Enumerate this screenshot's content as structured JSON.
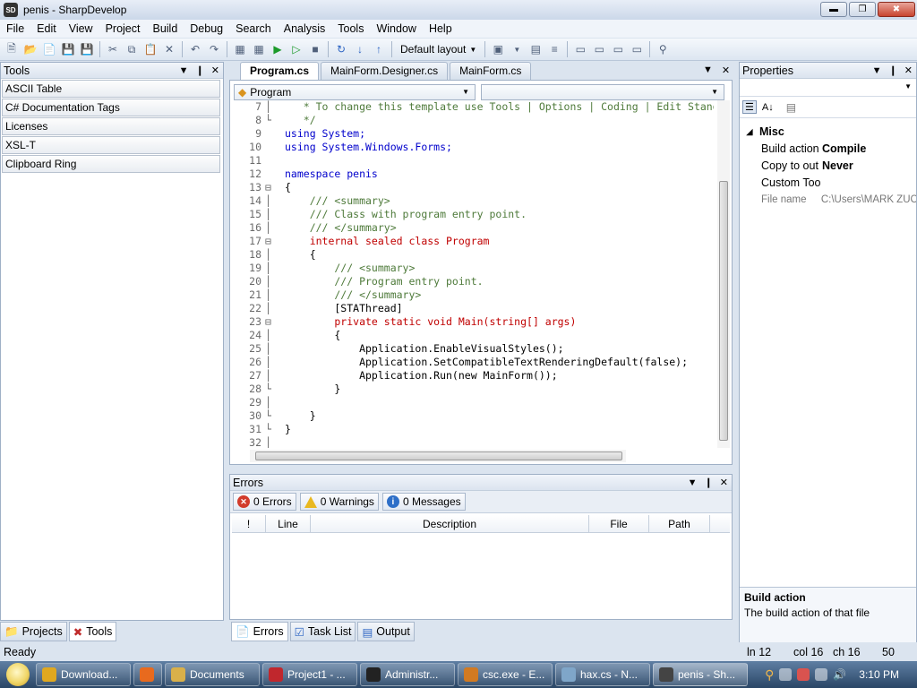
{
  "window": {
    "title": "penis - SharpDevelop"
  },
  "menu": [
    "File",
    "Edit",
    "View",
    "Project",
    "Build",
    "Debug",
    "Search",
    "Analysis",
    "Tools",
    "Window",
    "Help"
  ],
  "toolbar": {
    "layout": "Default layout"
  },
  "tools_panel": {
    "title": "Tools",
    "items": [
      "ASCII Table",
      "C# Documentation Tags",
      "Licenses",
      "XSL-T",
      "Clipboard Ring"
    ],
    "tabs": [
      "Projects",
      "Tools"
    ]
  },
  "editor": {
    "tabs": [
      "Program.cs",
      "MainForm.Designer.cs",
      "MainForm.cs"
    ],
    "class_combo": "Program",
    "member_combo": "",
    "lines": [
      {
        "n": "7",
        "t": "   * To change this template use Tools | Options | Coding | Edit Standard"
      },
      {
        "n": "8",
        "t": "   */"
      },
      {
        "n": "9",
        "t": "using System;"
      },
      {
        "n": "10",
        "t": "using System.Windows.Forms;"
      },
      {
        "n": "11",
        "t": ""
      },
      {
        "n": "12",
        "t": "namespace penis"
      },
      {
        "n": "13",
        "t": "{"
      },
      {
        "n": "14",
        "t": "    /// <summary>"
      },
      {
        "n": "15",
        "t": "    /// Class with program entry point."
      },
      {
        "n": "16",
        "t": "    /// </summary>"
      },
      {
        "n": "17",
        "t": "    internal sealed class Program"
      },
      {
        "n": "18",
        "t": "    {"
      },
      {
        "n": "19",
        "t": "        /// <summary>"
      },
      {
        "n": "20",
        "t": "        /// Program entry point."
      },
      {
        "n": "21",
        "t": "        /// </summary>"
      },
      {
        "n": "22",
        "t": "        [STAThread]"
      },
      {
        "n": "23",
        "t": "        private static void Main(string[] args)"
      },
      {
        "n": "24",
        "t": "        {"
      },
      {
        "n": "25",
        "t": "            Application.EnableVisualStyles();"
      },
      {
        "n": "26",
        "t": "            Application.SetCompatibleTextRenderingDefault(false);"
      },
      {
        "n": "27",
        "t": "            Application.Run(new MainForm());"
      },
      {
        "n": "28",
        "t": "        }"
      },
      {
        "n": "29",
        "t": ""
      },
      {
        "n": "30",
        "t": "    }"
      },
      {
        "n": "31",
        "t": "}"
      },
      {
        "n": "32",
        "t": ""
      }
    ]
  },
  "errors_panel": {
    "title": "Errors",
    "errors": "0 Errors",
    "warnings": "0 Warnings",
    "messages": "0 Messages",
    "columns": [
      "!",
      "Line",
      "Description",
      "File",
      "Path"
    ],
    "tabs": [
      "Errors",
      "Task List",
      "Output"
    ]
  },
  "properties_panel": {
    "title": "Properties",
    "category": "Misc",
    "rows": [
      {
        "name": "Build action",
        "value": "Compile"
      },
      {
        "name": "Copy to out",
        "value": "Never"
      },
      {
        "name": "Custom Too",
        "value": ""
      },
      {
        "name": "File name",
        "value": "C:\\Users\\MARK ZUC"
      }
    ],
    "desc_title": "Build action",
    "desc_text": "The build action of that file"
  },
  "status": {
    "ready": "Ready",
    "ln": "ln 12",
    "col": "col 16",
    "ch": "ch 16",
    "num": "50"
  },
  "taskbar": {
    "apps": [
      {
        "label": "Download...",
        "color": "#e0a820"
      },
      {
        "label": "",
        "color": "#e86a1e"
      },
      {
        "label": "Documents",
        "color": "#d9b04a"
      },
      {
        "label": "Project1 - ...",
        "color": "#c0272d"
      },
      {
        "label": "Administr...",
        "color": "#222222"
      },
      {
        "label": "csc.exe - E...",
        "color": "#d17a22"
      },
      {
        "label": "hax.cs - N...",
        "color": "#7fa6c9"
      },
      {
        "label": "penis - Sh...",
        "color": "#444444"
      }
    ],
    "clock": "3:10 PM"
  }
}
